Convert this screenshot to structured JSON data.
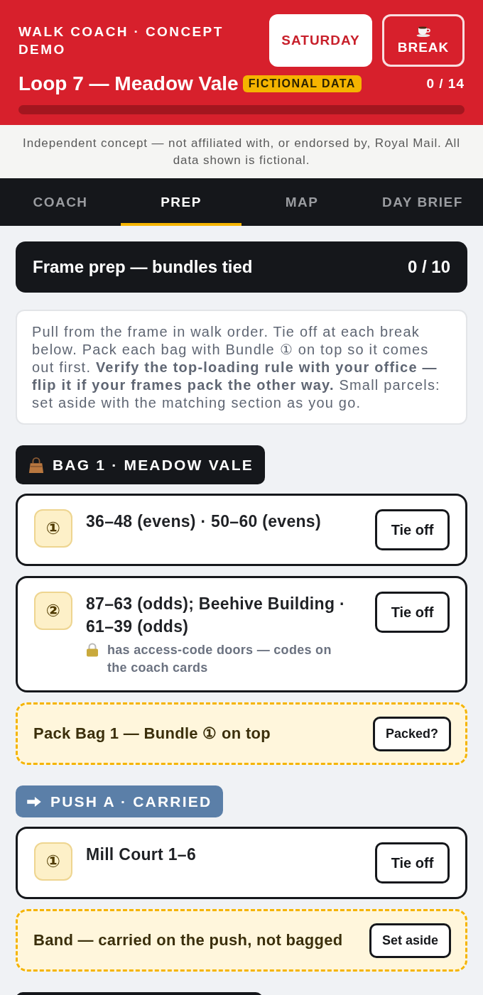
{
  "header": {
    "title": "WALK COACH · CONCEPT DEMO",
    "day_button": "SATURDAY",
    "break_button": "BREAK",
    "route": "Loop 7 — Meadow Vale",
    "badge": "FICTIONAL DATA",
    "count": "0 / 14",
    "progress": {
      "level": 0
    }
  },
  "disclaimer": "Independent concept — not affiliated with, or endorsed by, Royal Mail. All data shown is fictional.",
  "tabs": [
    {
      "label": "COACH",
      "selected": false
    },
    {
      "label": "PREP",
      "selected": true
    },
    {
      "label": "MAP",
      "selected": false
    },
    {
      "label": "DAY BRIEF",
      "selected": false
    }
  ],
  "frame_prep": {
    "title": "Frame prep — bundles tied",
    "count": "0 / 10",
    "instructions": "Pull from the frame in walk order. Tie off at each break below. Pack each bag with Bundle ① on top so it comes out first. **Verify the top-loading rule with your office — flip it if your frames pack the other way.** Small parcels: set aside with the matching section as you go."
  },
  "sections": [
    {
      "kind": "bag",
      "label": "BAG 1 · MEADOW VALE",
      "items": [
        {
          "kind": "bundle",
          "number": "①",
          "text": "36–48 (evens) · 50–60 (evens)",
          "action": "Tie off"
        },
        {
          "kind": "bundle",
          "number": "②",
          "text": "87–63 (odds); Beehive Building · 61–39 (odds)",
          "note": "has access-code doors — codes on the coach cards",
          "action": "Tie off"
        },
        {
          "kind": "reminder",
          "text": "Pack Bag 1 — Bundle ① on top",
          "action": "Packed?"
        }
      ]
    },
    {
      "kind": "push",
      "label": "PUSH A · CARRIED",
      "items": [
        {
          "kind": "bundle",
          "number": "①",
          "text": "Mill Court 1–6",
          "action": "Tie off"
        },
        {
          "kind": "reminder",
          "text": "Band — carried on the push, not bagged",
          "action": "Set aside"
        }
      ]
    },
    {
      "kind": "bag"
    }
  ]
}
